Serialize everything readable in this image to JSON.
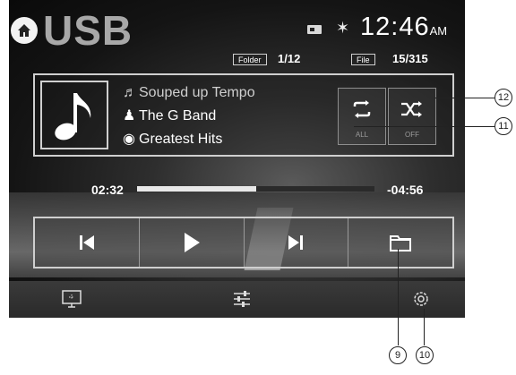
{
  "header": {
    "title": "USB",
    "time": "12:46",
    "ampm": "AM"
  },
  "status": {
    "folder_label": "Folder",
    "folder_value": "1/12",
    "file_label": "File",
    "file_value": "15/315"
  },
  "track": {
    "song": "Souped up Tempo",
    "artist": "The G Band",
    "album": "Greatest Hits"
  },
  "modes": {
    "repeat_label": "ALL",
    "shuffle_label": "OFF"
  },
  "playback": {
    "elapsed": "02:32",
    "remaining": "-04:56",
    "progress_fraction": 0.5
  },
  "icons": [
    "home-icon",
    "battery-icon",
    "bluetooth-icon",
    "music-note-icon",
    "artist-icon",
    "album-icon",
    "repeat-icon",
    "shuffle-icon",
    "previous-icon",
    "play-icon",
    "next-icon",
    "folder-icon",
    "display-icon",
    "equalizer-icon",
    "settings-icon"
  ],
  "callouts": {
    "c9": "9",
    "c10": "10",
    "c11": "11",
    "c12": "12"
  }
}
